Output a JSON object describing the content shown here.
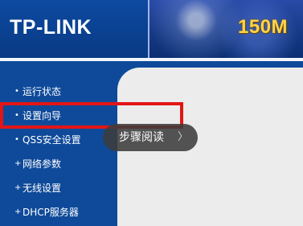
{
  "header": {
    "logo": "TP-LINK",
    "banner": "150M"
  },
  "sidebar": {
    "items": [
      {
        "bullet": "•",
        "label": "运行状态"
      },
      {
        "bullet": "•",
        "label": "设置向导"
      },
      {
        "bullet": "•",
        "label": "QSS安全设置"
      },
      {
        "bullet": "+",
        "label": "网络参数"
      },
      {
        "bullet": "+",
        "label": "无线设置"
      },
      {
        "bullet": "+",
        "label": "DHCP服务器"
      }
    ]
  },
  "tooltip": {
    "label": "步骤阅读",
    "chevron": "〉"
  },
  "colors": {
    "sidebar_bg": "#0f4a9a",
    "highlight_border": "#e31515",
    "content_bg": "#ececec"
  }
}
